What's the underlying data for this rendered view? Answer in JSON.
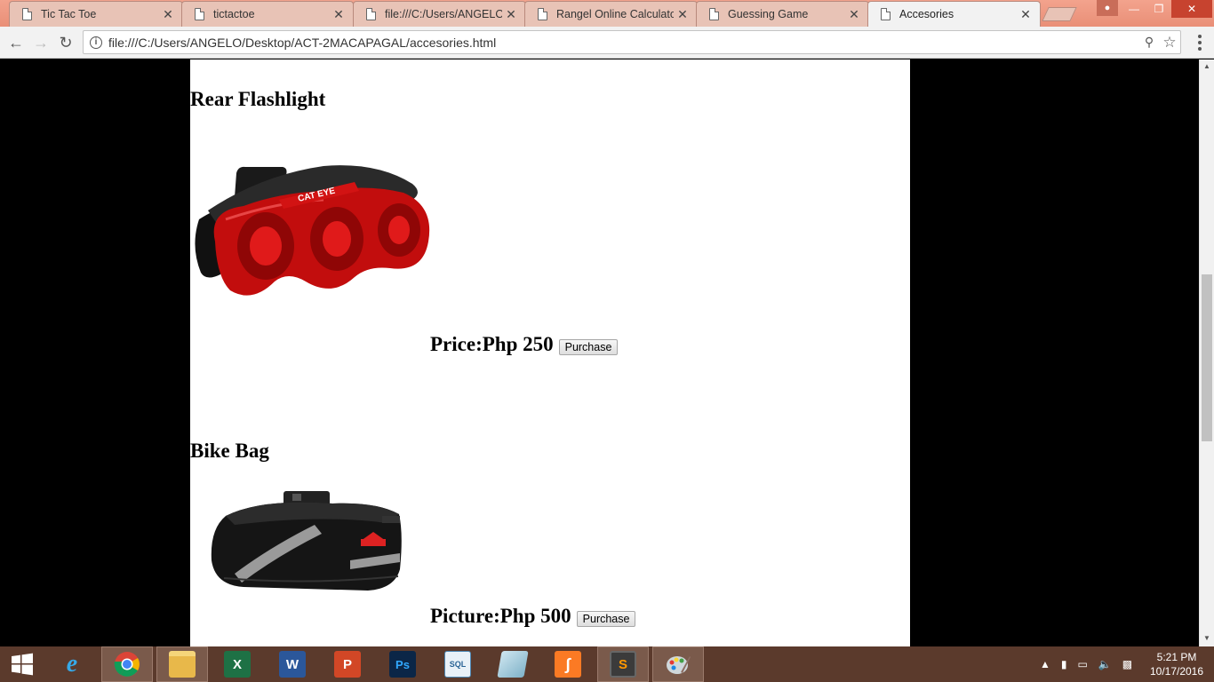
{
  "browser": {
    "tabs": [
      {
        "title": "Tic Tac Toe",
        "active": false
      },
      {
        "title": "tictactoe",
        "active": false
      },
      {
        "title": "file:///C:/Users/ANGELO/",
        "active": false
      },
      {
        "title": "Rangel Online Calculator",
        "active": false
      },
      {
        "title": "Guessing Game",
        "active": false
      },
      {
        "title": "Accesories",
        "active": true
      }
    ],
    "url": "file:///C:/Users/ANGELO/Desktop/ACT-2MACAPAGAL/accesories.html",
    "tab_close_glyph": "✕"
  },
  "page": {
    "products": [
      {
        "name": "Rear Flashlight",
        "price": "Price:Php 250",
        "button": "Purchase",
        "image_text": "CAT EYE"
      },
      {
        "name": "Bike Bag",
        "price": "Picture:Php 500",
        "button": "Purchase"
      }
    ]
  },
  "taskbar": {
    "apps": [
      "start-button",
      "internet-explorer",
      "google-chrome",
      "file-explorer",
      "excel",
      "word",
      "powerpoint",
      "photoshop",
      "mysql-installer",
      "app-generic",
      "xampp",
      "sublime-text",
      "paint"
    ],
    "time": "5:21 PM",
    "date": "10/17/2016"
  },
  "colors": {
    "tabstrip": "#ec967e",
    "page_bg": "#ffffff",
    "outer_bg": "#000000",
    "taskbar": "#5b3a2c"
  }
}
